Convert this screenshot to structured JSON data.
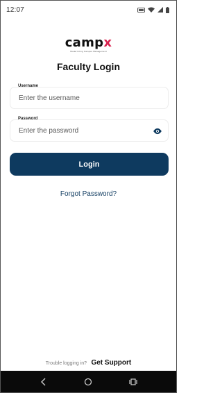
{
  "status_bar": {
    "time": "12:07",
    "icons": [
      "battery-saver-icon",
      "wifi-icon",
      "signal-icon",
      "battery-icon"
    ]
  },
  "logo": {
    "word_main": "camp",
    "word_accent": "x",
    "tagline": "Modernizing Campus Management"
  },
  "page": {
    "title": "Faculty Login"
  },
  "form": {
    "username_label": "Username",
    "username_placeholder": "Enter the username",
    "password_label": "Password",
    "password_placeholder": "Enter the password",
    "login_label": "Login",
    "forgot_label": "Forgot Password?"
  },
  "footer": {
    "trouble_text": "Trouble logging in?",
    "support_label": "Get Support"
  },
  "nav_bar": {
    "icons": [
      "back-icon",
      "home-icon",
      "recents-icon"
    ]
  },
  "colors": {
    "primary": "#0e3a5f",
    "logo_accent": "#d9234f",
    "nav_background": "#0a0a0a"
  }
}
